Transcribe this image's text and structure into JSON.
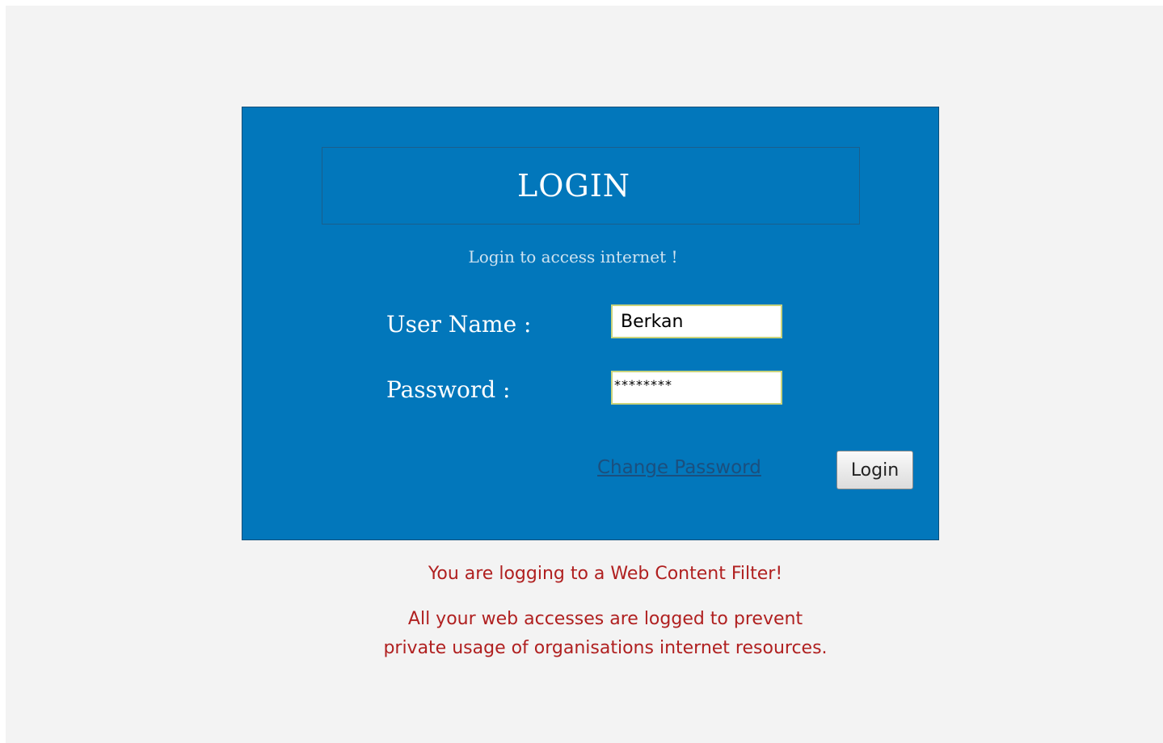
{
  "login_panel": {
    "title": "LOGIN",
    "subtitle": "Login to access internet !",
    "username_label": "User Name :",
    "username_value": "Berkan",
    "password_label": "Password :",
    "password_value": "********",
    "change_password_link": "Change Password",
    "login_button": "Login"
  },
  "notices": {
    "line1": "You are logging to a Web Content Filter!",
    "line2": "All your web accesses are logged to prevent",
    "line3": "private usage of organisations internet resources."
  },
  "colors": {
    "panel_background": "#0277bb",
    "page_background": "#f3f3f3",
    "notice_text": "#b02020"
  }
}
